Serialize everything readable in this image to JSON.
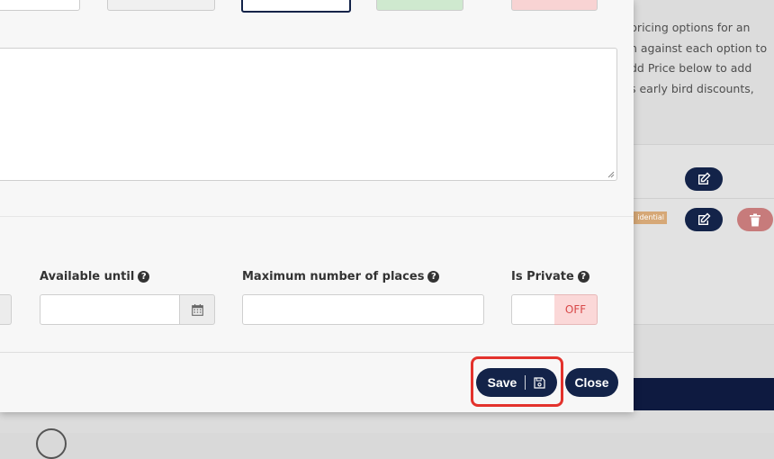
{
  "background": {
    "info_lines": [
      "pricing options for an",
      "n against each option to",
      "dd Price below to add",
      "s early bird discounts,"
    ],
    "badge": "idential"
  },
  "form": {
    "available_until": {
      "label": "Available until",
      "value": ""
    },
    "maximum_places": {
      "label": "Maximum number of places",
      "value": ""
    },
    "is_private": {
      "label": "Is Private",
      "toggle_text": "OFF"
    }
  },
  "footer": {
    "save_label": "Save",
    "close_label": "Close"
  },
  "colors": {
    "primary": "#132349",
    "highlight": "#e3322c",
    "off_bg": "#fbd8d8",
    "off_text": "#d84848"
  }
}
